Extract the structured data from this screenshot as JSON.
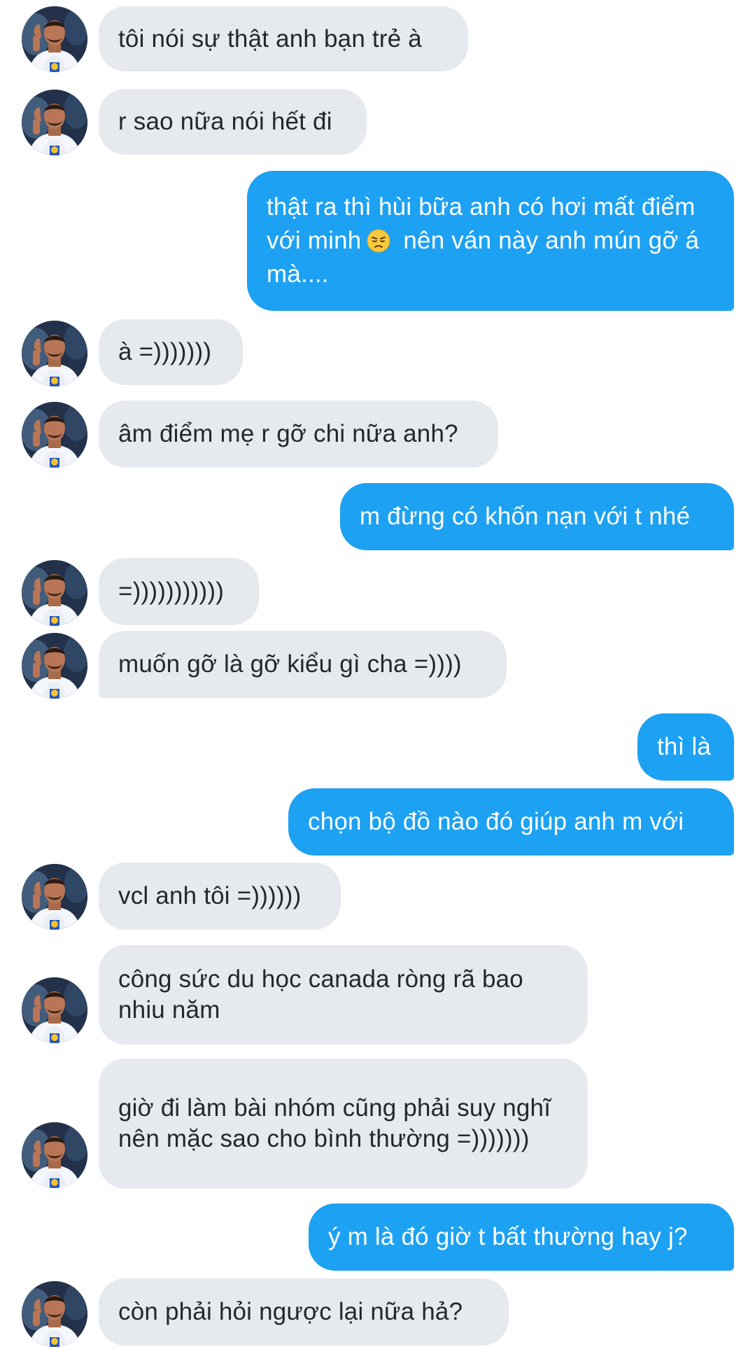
{
  "conversation": {
    "messages": [
      {
        "from": "them",
        "text": "tôi nói sự thật anh bạn trẻ à"
      },
      {
        "from": "them",
        "text": "r sao nữa nói hết đi"
      },
      {
        "from": "me",
        "text_before_emoji": "thật ra thì hùi bữa anh có hơi mất điểm với minh",
        "emoji": "disappointed-face",
        "text_after_emoji": "nên ván này anh mún gỡ á mà...."
      },
      {
        "from": "them",
        "text": "à =)))))))"
      },
      {
        "from": "them",
        "text": "âm điểm mẹ r gỡ chi nữa anh?"
      },
      {
        "from": "me",
        "text": "m đừng có khốn nạn với t nhé"
      },
      {
        "from": "them",
        "text": "=)))))))))))"
      },
      {
        "from": "them",
        "text": "muốn gỡ là gỡ kiểu gì cha =))))"
      },
      {
        "from": "me",
        "text": "thì là"
      },
      {
        "from": "me",
        "text": "chọn bộ đồ nào đó giúp anh m với"
      },
      {
        "from": "them",
        "text": "vcl anh tôi =))))))"
      },
      {
        "from": "them",
        "text": "công sức du học canada ròng rã bao nhiu năm"
      },
      {
        "from": "them",
        "text": "giờ đi làm bài nhóm cũng phải suy nghĩ nên mặc sao cho bình thường =)))))))"
      },
      {
        "from": "me",
        "text": "ý m là đó giờ t bất thường hay j?"
      },
      {
        "from": "them",
        "text": "còn phải hỏi ngược lại nữa hả?"
      }
    ]
  },
  "colors": {
    "incoming_bubble": "#e6e9ee",
    "incoming_text": "#23282d",
    "outgoing_bubble": "#1da1f2",
    "outgoing_text": "#ffffff"
  },
  "icons": {
    "avatar": "contact-avatar-photo",
    "emoji": "disappointed-face-emoji"
  }
}
